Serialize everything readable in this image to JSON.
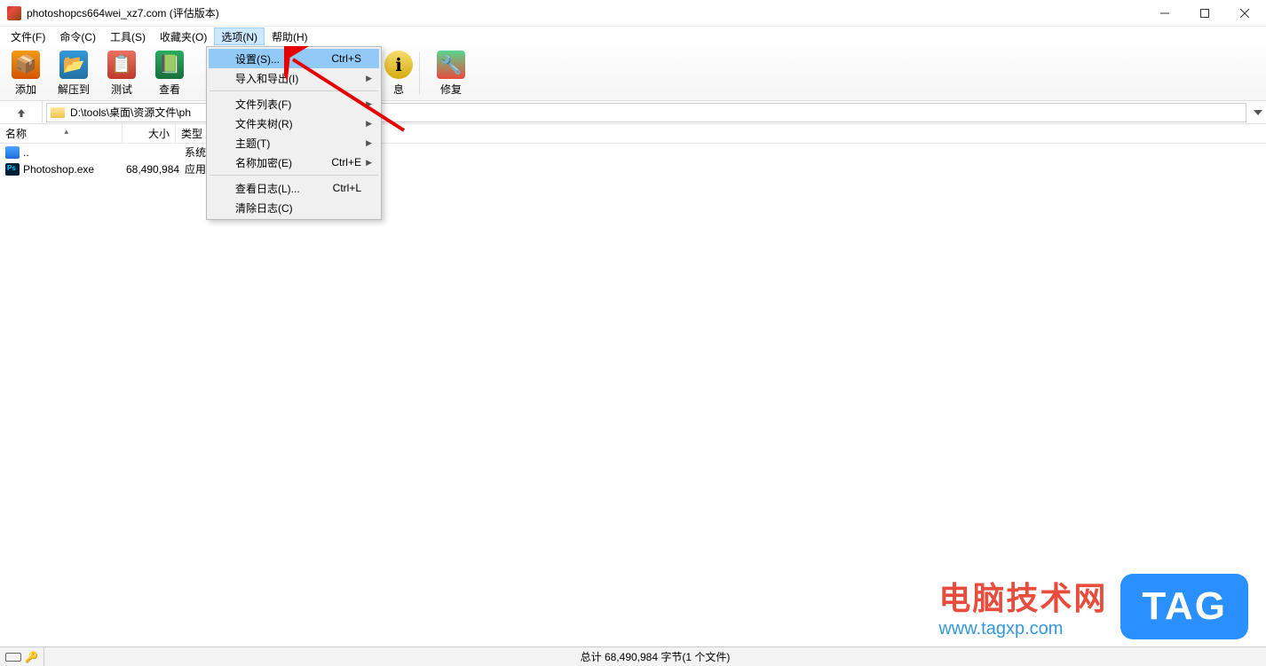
{
  "window": {
    "title": "photoshopcs664wei_xz7.com (评估版本)"
  },
  "menubar": {
    "items": [
      {
        "label": "文件(F)"
      },
      {
        "label": "命令(C)"
      },
      {
        "label": "工具(S)"
      },
      {
        "label": "收藏夹(O)"
      },
      {
        "label": "选项(N)",
        "active": true
      },
      {
        "label": "帮助(H)"
      }
    ]
  },
  "toolbar": {
    "items": [
      {
        "label": "添加",
        "name": "add-button"
      },
      {
        "label": "解压到",
        "name": "extract-button"
      },
      {
        "label": "测试",
        "name": "test-button"
      },
      {
        "label": "查看",
        "name": "view-button"
      }
    ],
    "hidden_info": {
      "label": "息",
      "name": "info-button"
    },
    "repair": {
      "label": "修复",
      "name": "repair-button"
    }
  },
  "dropdown": {
    "items": [
      {
        "label": "设置(S)...",
        "shortcut": "Ctrl+S",
        "highlighted": true
      },
      {
        "label": "导入和导出(I)",
        "submenu": true
      },
      {
        "sep": true
      },
      {
        "label": "文件列表(F)",
        "submenu": true
      },
      {
        "label": "文件夹树(R)",
        "submenu": true
      },
      {
        "label": "主题(T)",
        "submenu": true
      },
      {
        "label": "名称加密(E)",
        "shortcut": "Ctrl+E",
        "submenu": true
      },
      {
        "sep": true
      },
      {
        "label": "查看日志(L)...",
        "shortcut": "Ctrl+L"
      },
      {
        "label": "清除日志(C)"
      }
    ]
  },
  "path": {
    "value": "D:\\tools\\桌面\\资源文件\\ph"
  },
  "columns": {
    "name": "名称",
    "size": "大小",
    "type": "类型"
  },
  "files": [
    {
      "icon": "folder-up",
      "name": "..",
      "size": "",
      "type": "系统"
    },
    {
      "icon": "ps",
      "name": "Photoshop.exe",
      "size": "68,490,984",
      "type": "应用"
    }
  ],
  "statusbar": {
    "text": "总计 68,490,984 字节(1 个文件)"
  },
  "watermark": {
    "cn": "电脑技术网",
    "url": "www.tagxp.com",
    "tag": "TAG"
  }
}
